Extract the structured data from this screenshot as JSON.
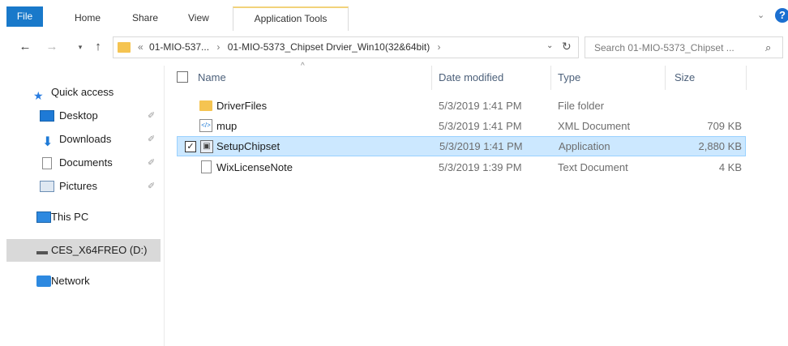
{
  "ribbon": {
    "tabs": [
      "File",
      "Home",
      "Share",
      "View",
      "Application Tools"
    ],
    "help_label": "?"
  },
  "navigation": {
    "back_glyph": "←",
    "forward_glyph": "→",
    "recent_glyph": "▾",
    "up_glyph": "↑"
  },
  "address": {
    "prefix": "«",
    "segment1": "01-MIO-537...",
    "separator": "›",
    "segment2": "01-MIO-5373_Chipset Drvier_Win10(32&64bit)",
    "trailing_chevron": "›",
    "dropdown_glyph": "⌄",
    "refresh_glyph": "↻"
  },
  "search": {
    "placeholder": "Search 01-MIO-5373_Chipset ...",
    "icon_glyph": "⌕"
  },
  "sidebar": {
    "items": [
      {
        "label": "Quick access",
        "icon": "star-icon",
        "pinned": false
      },
      {
        "label": "Desktop",
        "icon": "desktop-icon",
        "pinned": true
      },
      {
        "label": "Downloads",
        "icon": "downloads-icon",
        "pinned": true
      },
      {
        "label": "Documents",
        "icon": "documents-icon",
        "pinned": true
      },
      {
        "label": "Pictures",
        "icon": "pictures-icon",
        "pinned": true
      },
      {
        "label": "This PC",
        "icon": "this-pc-icon",
        "pinned": false
      },
      {
        "label": "CES_X64FREO (D:)",
        "icon": "drive-icon",
        "pinned": false
      },
      {
        "label": "Network",
        "icon": "network-icon",
        "pinned": false
      }
    ],
    "pin_glyph": "✐"
  },
  "columns": {
    "name": "Name",
    "date": "Date modified",
    "type": "Type",
    "size": "Size",
    "sort_glyph": "^"
  },
  "files": [
    {
      "name": "DriverFiles",
      "date": "5/3/2019 1:41 PM",
      "type": "File folder",
      "size": "",
      "icon": "folder-icon"
    },
    {
      "name": "mup",
      "date": "5/3/2019 1:41 PM",
      "type": "XML Document",
      "size": "709 KB",
      "icon": "xml-document-icon"
    },
    {
      "name": "SetupChipset",
      "date": "5/3/2019 1:41 PM",
      "type": "Application",
      "size": "2,880 KB",
      "icon": "application-icon",
      "selected": true,
      "checked": true
    },
    {
      "name": "WixLicenseNote",
      "date": "5/3/2019 1:39 PM",
      "type": "Text Document",
      "size": "4 KB",
      "icon": "text-document-icon"
    }
  ],
  "colors": {
    "file_tab": "#1979ca",
    "selection_bg": "#cce8ff",
    "selection_border": "#99d1ff",
    "sidebar_selected": "#d9d9d9",
    "folder": "#f5c451"
  }
}
